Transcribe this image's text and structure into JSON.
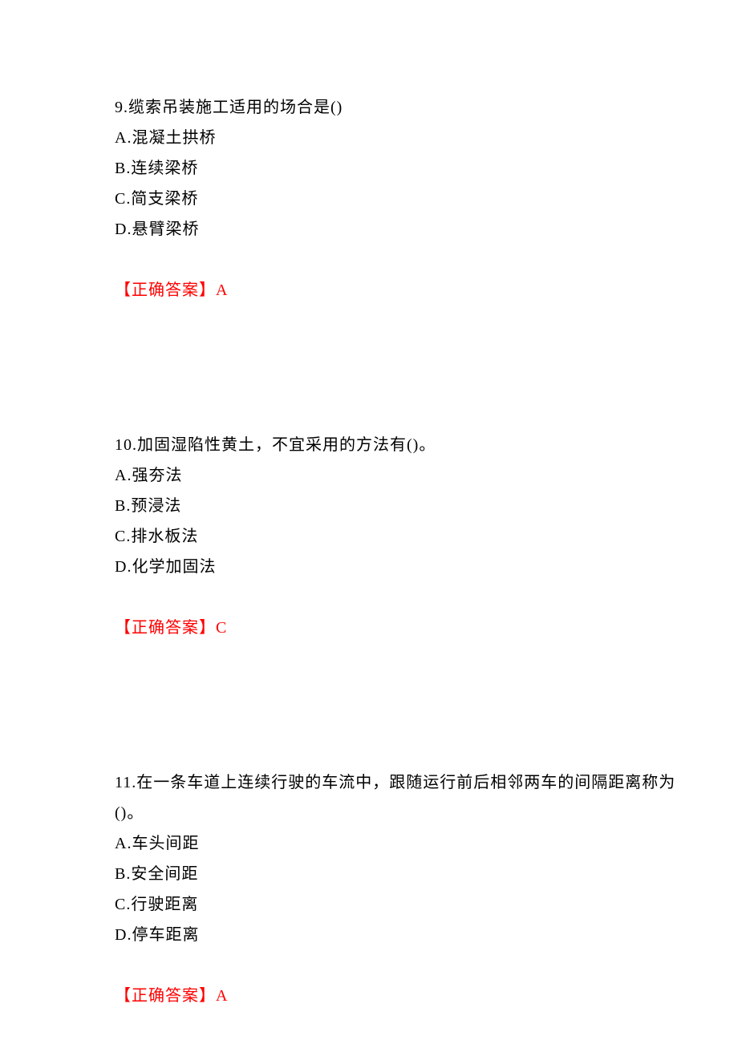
{
  "questions": [
    {
      "number": "9.",
      "text": "缆索吊装施工适用的场合是()",
      "options": {
        "a": "A.混凝土拱桥",
        "b": "B.连续梁桥",
        "c": "C.简支梁桥",
        "d": "D.悬臂梁桥"
      },
      "answer_label": "【正确答案】",
      "answer_value": "A"
    },
    {
      "number": "10.",
      "text": "加固湿陷性黄土，不宜采用的方法有()。",
      "options": {
        "a": "A.强夯法",
        "b": "B.预浸法",
        "c": "C.排水板法",
        "d": "D.化学加固法"
      },
      "answer_label": "【正确答案】",
      "answer_value": "C"
    },
    {
      "number": "11.",
      "text": "在一条车道上连续行驶的车流中，跟随运行前后相邻两车的间隔距离称为()。",
      "options": {
        "a": "A.车头间距",
        "b": "B.安全间距",
        "c": "C.行驶距离",
        "d": "D.停车距离"
      },
      "answer_label": "【正确答案】",
      "answer_value": "A"
    }
  ]
}
